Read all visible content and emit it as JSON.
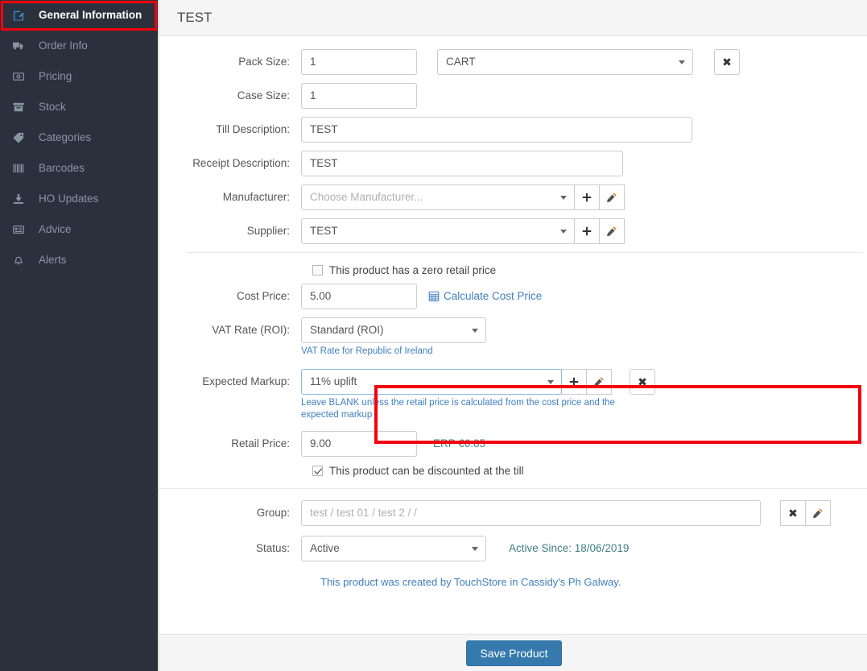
{
  "sidebar": {
    "items": [
      {
        "label": "General Information",
        "icon": "edit-square-icon",
        "active": true
      },
      {
        "label": "Order Info",
        "icon": "truck-icon",
        "active": false
      },
      {
        "label": "Pricing",
        "icon": "money-bill-icon",
        "active": false
      },
      {
        "label": "Stock",
        "icon": "archive-box-icon",
        "active": false
      },
      {
        "label": "Categories",
        "icon": "tag-icon",
        "active": false
      },
      {
        "label": "Barcodes",
        "icon": "barcode-icon",
        "active": false
      },
      {
        "label": "HO Updates",
        "icon": "download-icon",
        "active": false
      },
      {
        "label": "Advice",
        "icon": "id-card-icon",
        "active": false
      },
      {
        "label": "Alerts",
        "icon": "bell-icon",
        "active": false
      }
    ]
  },
  "header": {
    "title": "TEST"
  },
  "form": {
    "pack_size": {
      "label": "Pack Size:",
      "value": "1",
      "unit_value": "CART",
      "clear_label": "✖"
    },
    "case_size": {
      "label": "Case Size:",
      "value": "1"
    },
    "till_description": {
      "label": "Till Description:",
      "value": "TEST"
    },
    "receipt_description": {
      "label": "Receipt Description:",
      "value": "TEST"
    },
    "manufacturer": {
      "label": "Manufacturer:",
      "placeholder": "Choose Manufacturer...",
      "add_label": "+",
      "edit_label": "✎"
    },
    "supplier": {
      "label": "Supplier:",
      "value": "TEST",
      "add_label": "+",
      "edit_label": "✎"
    },
    "zero_retail": {
      "label": "This product has a zero retail price",
      "checked": false
    },
    "cost_price": {
      "label": "Cost Price:",
      "value": "5.00",
      "calc_link": "Calculate Cost Price"
    },
    "vat_rate": {
      "label": "VAT Rate (ROI):",
      "value": "Standard (ROI)",
      "hint": "VAT Rate for Republic of Ireland"
    },
    "expected_markup": {
      "label": "Expected Markup:",
      "value": "11% uplift",
      "hint": "Leave BLANK unless the retail price is calculated from the cost price and the expected markup",
      "add_label": "+",
      "edit_label": "✎",
      "clear_label": "✖"
    },
    "retail_price": {
      "label": "Retail Price:",
      "value": "9.00",
      "erp": "ERP €6.85"
    },
    "discountable": {
      "label": "This product can be discounted at the till",
      "checked": true
    },
    "group": {
      "label": "Group:",
      "value": "test / test 01 / test 2 /  /",
      "clear_label": "✖",
      "edit_label": "✎"
    },
    "status": {
      "label": "Status:",
      "value": "Active",
      "since": "Active Since: 18/06/2019"
    },
    "created_note": "This product was created by TouchStore in Cassidy's Ph Galway."
  },
  "footer": {
    "save_label": "Save Product"
  },
  "colors": {
    "sidebar_bg": "#2b313c",
    "accent_blue": "#3a8fd4",
    "annotation_red": "#f3000d",
    "save_blue": "#3679ad",
    "link_blue": "#3f7fbf"
  }
}
